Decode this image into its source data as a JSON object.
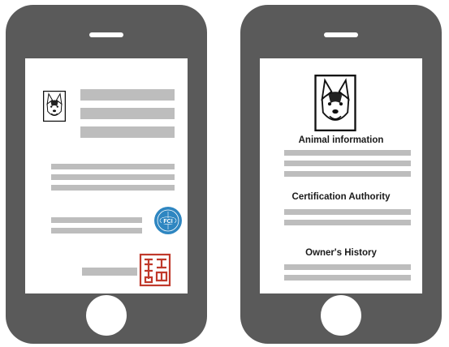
{
  "phones": {
    "left": {
      "screen": "certificate",
      "fci_seal_text": "FCI"
    },
    "right": {
      "screen": "record",
      "sections": [
        {
          "title": "Animal information"
        },
        {
          "title": "Certification Authority"
        },
        {
          "title": "Owner's History"
        }
      ]
    }
  },
  "colors": {
    "phone_body": "#5a5a5a",
    "placeholder_bar": "#bdbdbd",
    "fci_blue": "#2e86c1",
    "stamp_red": "#c0392b"
  }
}
